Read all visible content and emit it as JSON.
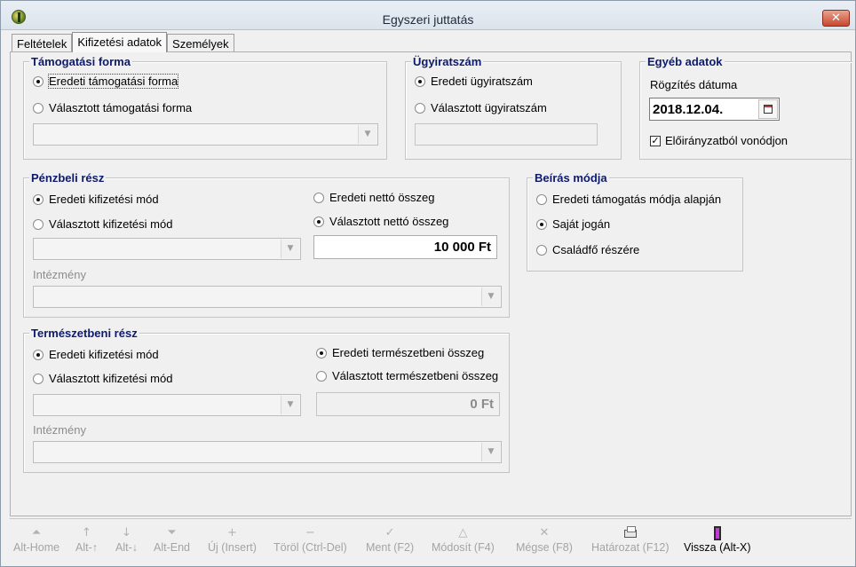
{
  "window": {
    "title": "Egyszeri juttatás"
  },
  "tabs": [
    {
      "label": "Feltételek",
      "active": false
    },
    {
      "label": "Kifizetési adatok",
      "active": true
    },
    {
      "label": "Személyek",
      "active": false
    }
  ],
  "tamogatasi_forma": {
    "legend": "Támogatási forma",
    "option_original": "Eredeti támogatási forma",
    "option_selected": "Választott támogatási forma",
    "selected": "Eredeti támogatási forma",
    "combo_value": ""
  },
  "ugyiratszam": {
    "legend": "Ügyiratszám",
    "option_original": "Eredeti ügyiratszám",
    "option_selected": "Választott ügyiratszám",
    "selected": "Eredeti ügyiratszám",
    "field_value": ""
  },
  "egyeb_adatok": {
    "legend": "Egyéb adatok",
    "date_label": "Rögzítés dátuma",
    "date_value": "2018.12.04.",
    "checkbox_label": "Előirányzatból vonódjon",
    "checkbox_checked": true
  },
  "penzbeli_resz": {
    "legend": "Pénzbeli rész",
    "option_original_mode": "Eredeti kifizetési mód",
    "option_selected_mode": "Választott kifizetési mód",
    "selected_mode": "Eredeti kifizetési mód",
    "option_original_net": "Eredeti nettó összeg",
    "option_selected_net": "Választott nettó összeg",
    "selected_net": "Választott nettó összeg",
    "amount": "10 000 Ft",
    "institution_label": "Intézmény"
  },
  "beiras_modja": {
    "legend": "Beírás módja",
    "options": [
      "Eredeti támogatás módja alapján",
      "Saját jogán",
      "Családfő részére"
    ],
    "selected": "Saját jogán"
  },
  "termeszetbeni_resz": {
    "legend": "Természetbeni rész",
    "option_original_mode": "Eredeti kifizetési mód",
    "option_selected_mode": "Választott kifizetési mód",
    "selected_mode": "Eredeti kifizetési mód",
    "option_original_sum": "Eredeti természetbeni összeg",
    "option_selected_sum": "Választott természetbeni összeg",
    "selected_sum": "Eredeti természetbeni összeg",
    "amount": "0 Ft",
    "institution_label": "Intézmény"
  },
  "toolbar": {
    "alt_home": "Alt-Home",
    "alt_up": "Alt-↑",
    "alt_down": "Alt-↓",
    "alt_end": "Alt-End",
    "new": "Új (Insert)",
    "delete": "Töröl (Ctrl-Del)",
    "save": "Ment (F2)",
    "modify": "Módosít (F4)",
    "cancel": "Mégse (F8)",
    "resolution": "Határozat (F12)",
    "back": "Vissza (Alt-X)"
  }
}
